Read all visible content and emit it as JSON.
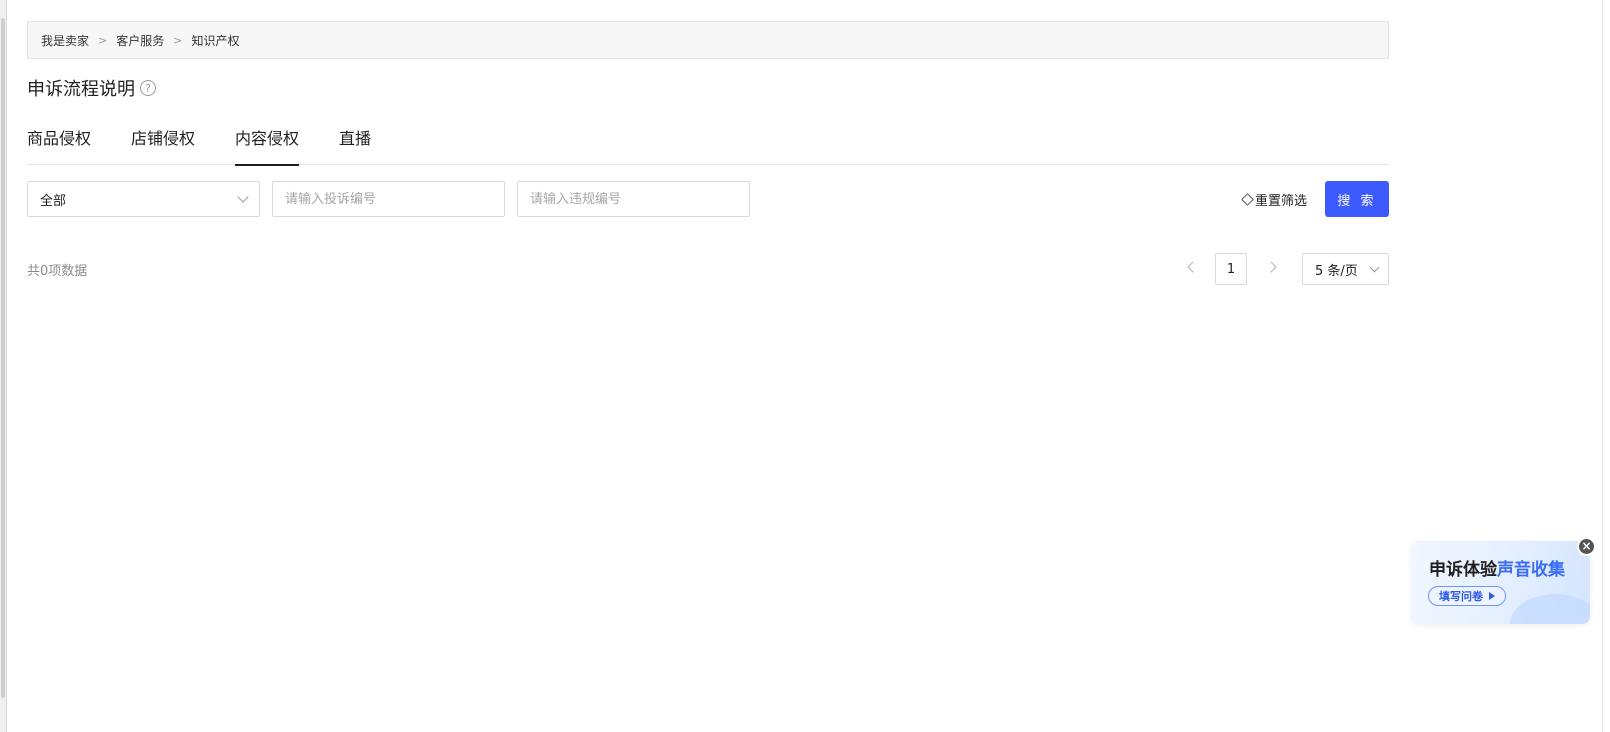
{
  "breadcrumb": {
    "items": [
      "我是卖家",
      "客户服务",
      "知识产权"
    ],
    "separator": ">"
  },
  "page": {
    "title": "申诉流程说明",
    "help_icon": "?"
  },
  "tabs": [
    {
      "label": "商品侵权",
      "active": false
    },
    {
      "label": "店铺侵权",
      "active": false
    },
    {
      "label": "内容侵权",
      "active": true
    },
    {
      "label": "直播",
      "active": false
    }
  ],
  "filters": {
    "status_select": {
      "value": "全部"
    },
    "complaint_no": {
      "placeholder": "请输入投诉编号",
      "value": ""
    },
    "violation_no": {
      "placeholder": "请输入违规编号",
      "value": ""
    },
    "reset_label": "重置筛选",
    "search_label": "搜 索"
  },
  "results": {
    "total_text": "共0项数据"
  },
  "pagination": {
    "current_page": "1",
    "page_size": "5 条/页"
  },
  "survey": {
    "title_part1": "申诉体验",
    "title_part2": "声音收集",
    "cta": "填写问卷",
    "close": "×"
  },
  "colors": {
    "accent": "#3d5afe",
    "survey_highlight": "#3a6cf5"
  }
}
